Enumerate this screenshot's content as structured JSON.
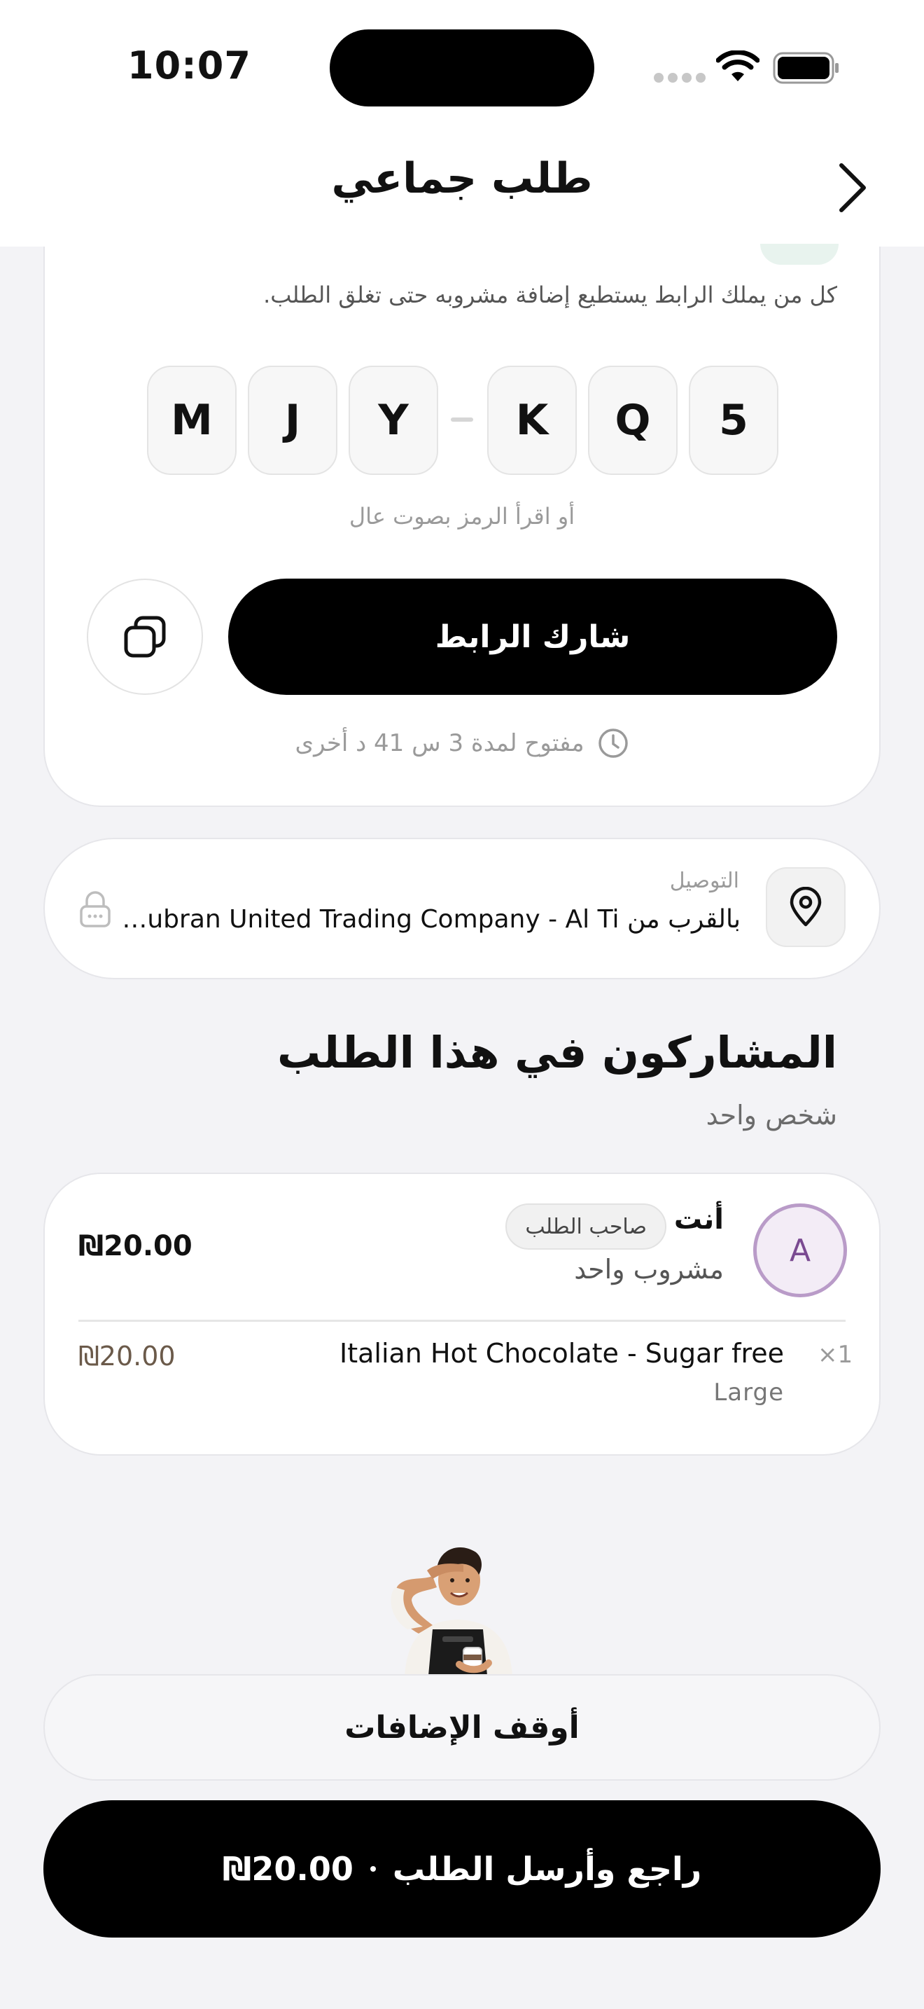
{
  "status_bar": {
    "time": "10:07"
  },
  "header": {
    "title": "طلب جماعي"
  },
  "share_card": {
    "description": "كل من يملك الرابط يستطيع إضافة مشروبه حتى تغلق الطلب.",
    "code_chars": [
      "M",
      "J",
      "Y",
      "K",
      "Q",
      "5"
    ],
    "readout_hint": "أو اقرأ الرمز بصوت عال",
    "share_label": "شارك الرابط",
    "open_duration": "مفتوح لمدة 3 س 41 د أخرى"
  },
  "delivery": {
    "label": "التوصيل",
    "address": "بالقرب من Jubran United Trading Company - Al Ti..."
  },
  "participants": {
    "title": "المشاركون في هذا الطلب",
    "count_label": "شخص واحد",
    "list": [
      {
        "avatar_letter": "A",
        "name": "أنت",
        "badge": "صاحب الطلب",
        "drinks_label": "مشروب واحد",
        "total": "₪20.00",
        "items": [
          {
            "qty": "×1",
            "name": "Italian Hot Chocolate - Sugar free",
            "size": "Large",
            "price": "₪20.00"
          }
        ]
      }
    ]
  },
  "actions": {
    "stop_label": "أوقف الإضافات",
    "submit_label": "راجع وأرسل الطلب",
    "submit_price": "₪20.00"
  },
  "colors": {
    "accent": "#000000",
    "avatar_ring": "#b99bc8",
    "background": "#f3f3f6"
  },
  "icons": [
    "chevron-right-icon",
    "copy-icon",
    "clock-icon",
    "location-pin-icon",
    "lock-icon",
    "wifi-icon",
    "battery-icon"
  ]
}
